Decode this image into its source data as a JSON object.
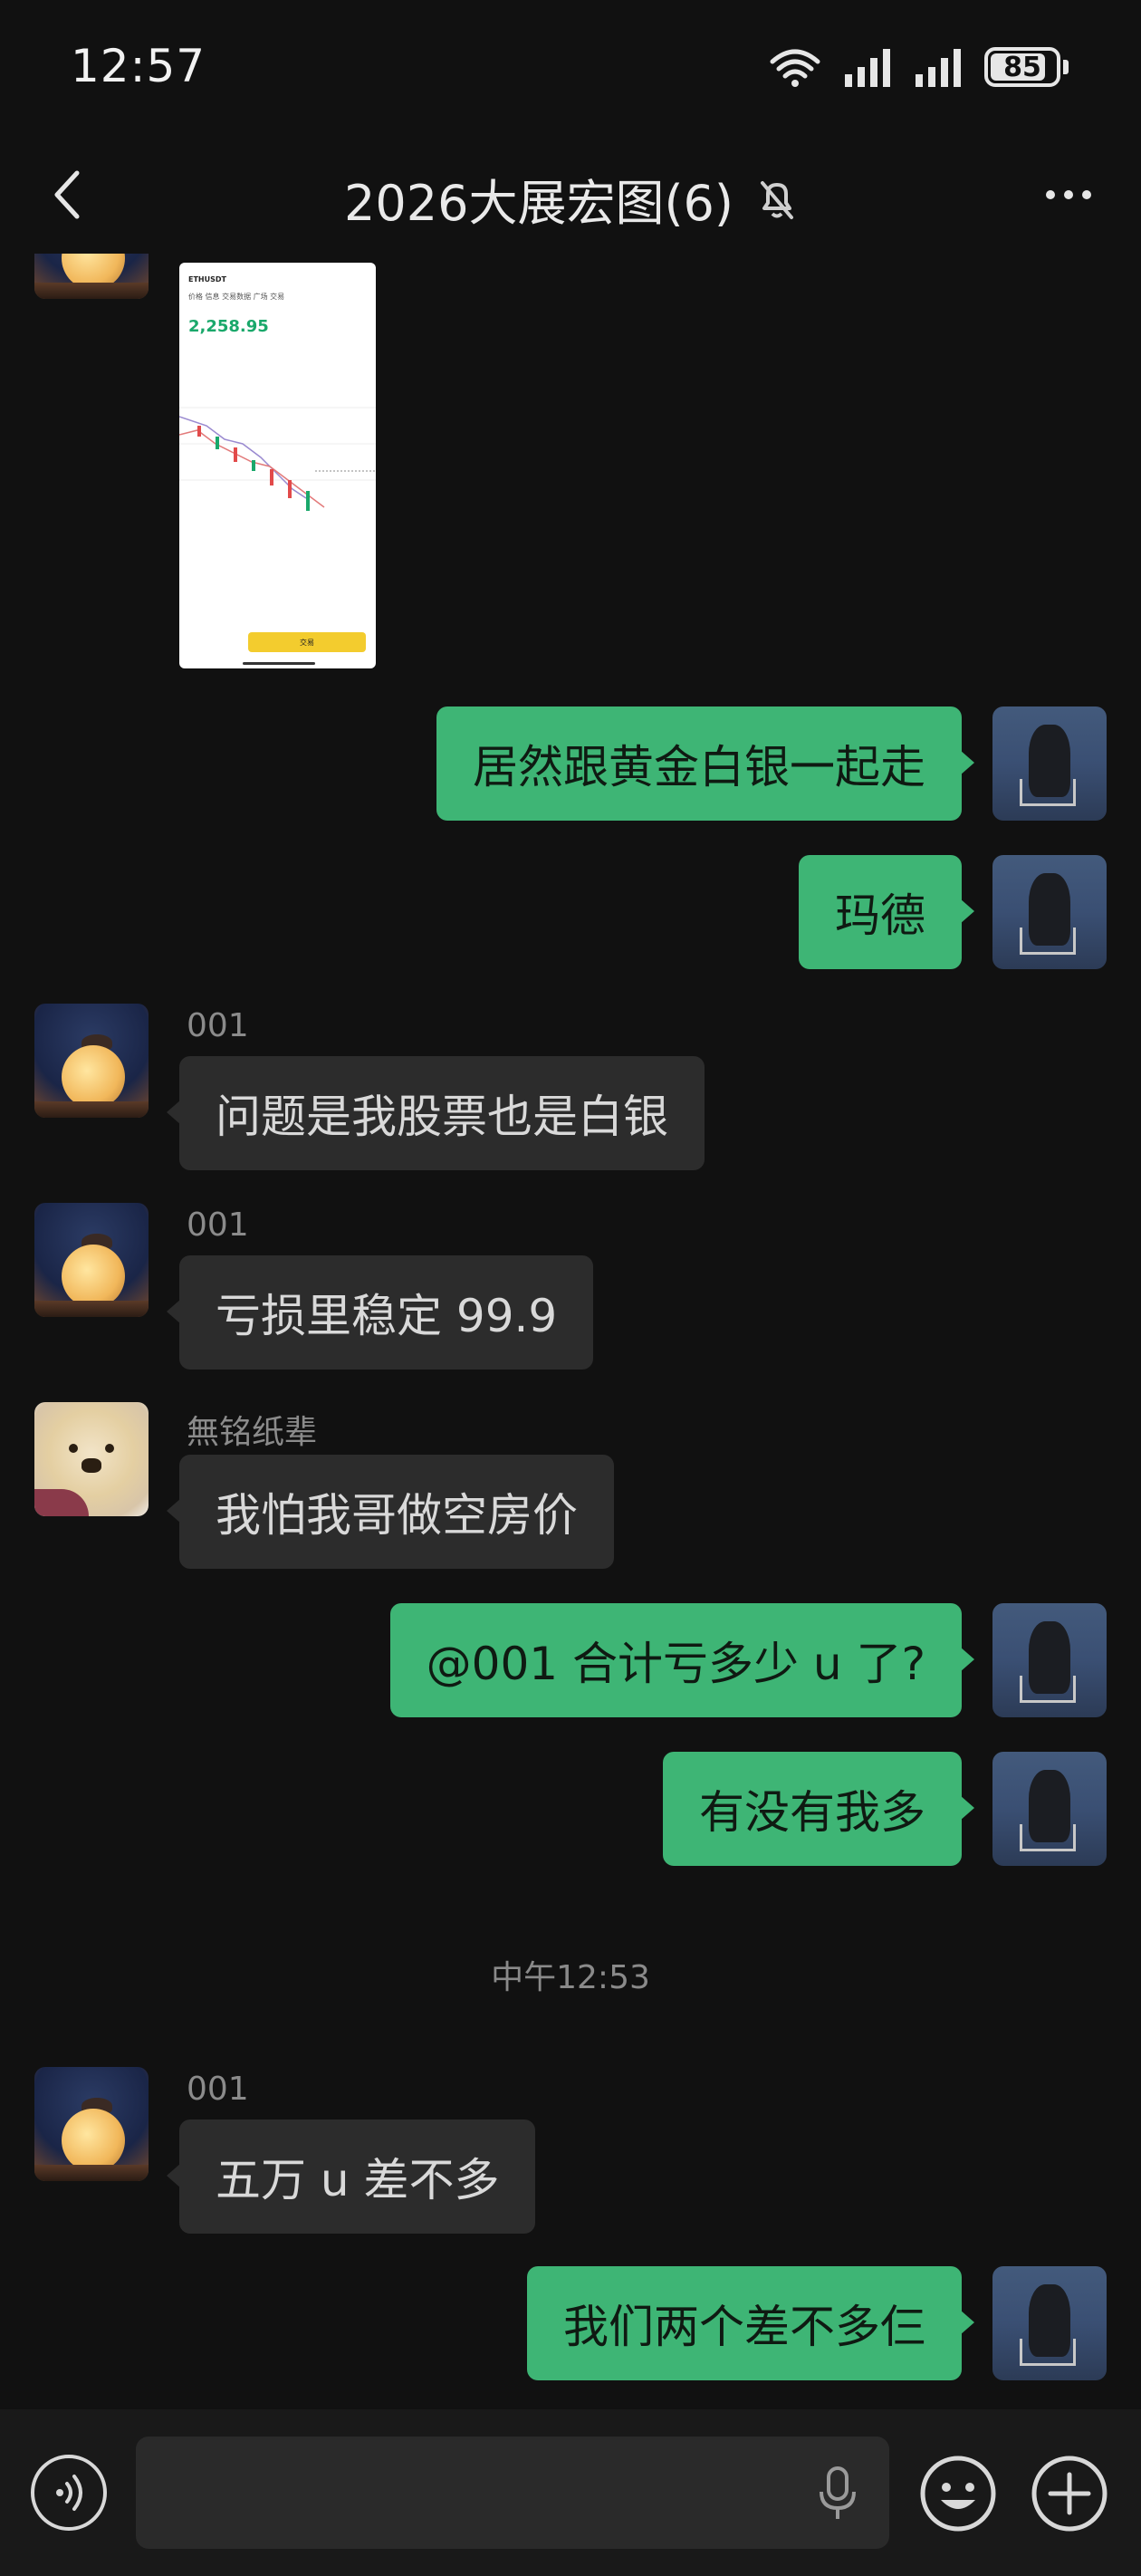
{
  "status_bar": {
    "time": "12:57",
    "battery": "85",
    "battery_level": 0.85
  },
  "header": {
    "title": "2026大展宏图(6)",
    "muted": true
  },
  "chat": {
    "image_message": {
      "pair": "ETHUSDT",
      "price": "2,258.95",
      "trade_label": "交易"
    },
    "messages": [
      {
        "side": "out",
        "text": "居然跟黄金白银一起走"
      },
      {
        "side": "out",
        "text": "玛德"
      },
      {
        "side": "in",
        "sender": "001",
        "text": "问题是我股票也是白银"
      },
      {
        "side": "in",
        "sender": "001",
        "text": "亏损里稳定 99.9"
      },
      {
        "side": "in",
        "sender": "無铭纸辈",
        "text": "我怕我哥做空房价"
      },
      {
        "side": "out",
        "text": "@001  合计亏多少 u 了?"
      },
      {
        "side": "out",
        "text": "有没有我多"
      },
      {
        "side": "in",
        "sender": "001",
        "text": "五万 u 差不多"
      },
      {
        "side": "out",
        "text": "我们两个差不多仨"
      }
    ],
    "timestamp": "中午12:53"
  },
  "input": {
    "value": "",
    "placeholder": ""
  },
  "colors": {
    "background": "#111111",
    "bubble_out": "#3eb575",
    "bubble_in": "#2c2c2c",
    "bottom_bar": "#191919"
  },
  "icons": [
    "back-arrow-icon",
    "mute-bell-icon",
    "more-icon",
    "voice-icon",
    "mic-icon",
    "emoji-icon",
    "plus-icon",
    "wifi-icon",
    "signal-icon",
    "battery-icon"
  ]
}
